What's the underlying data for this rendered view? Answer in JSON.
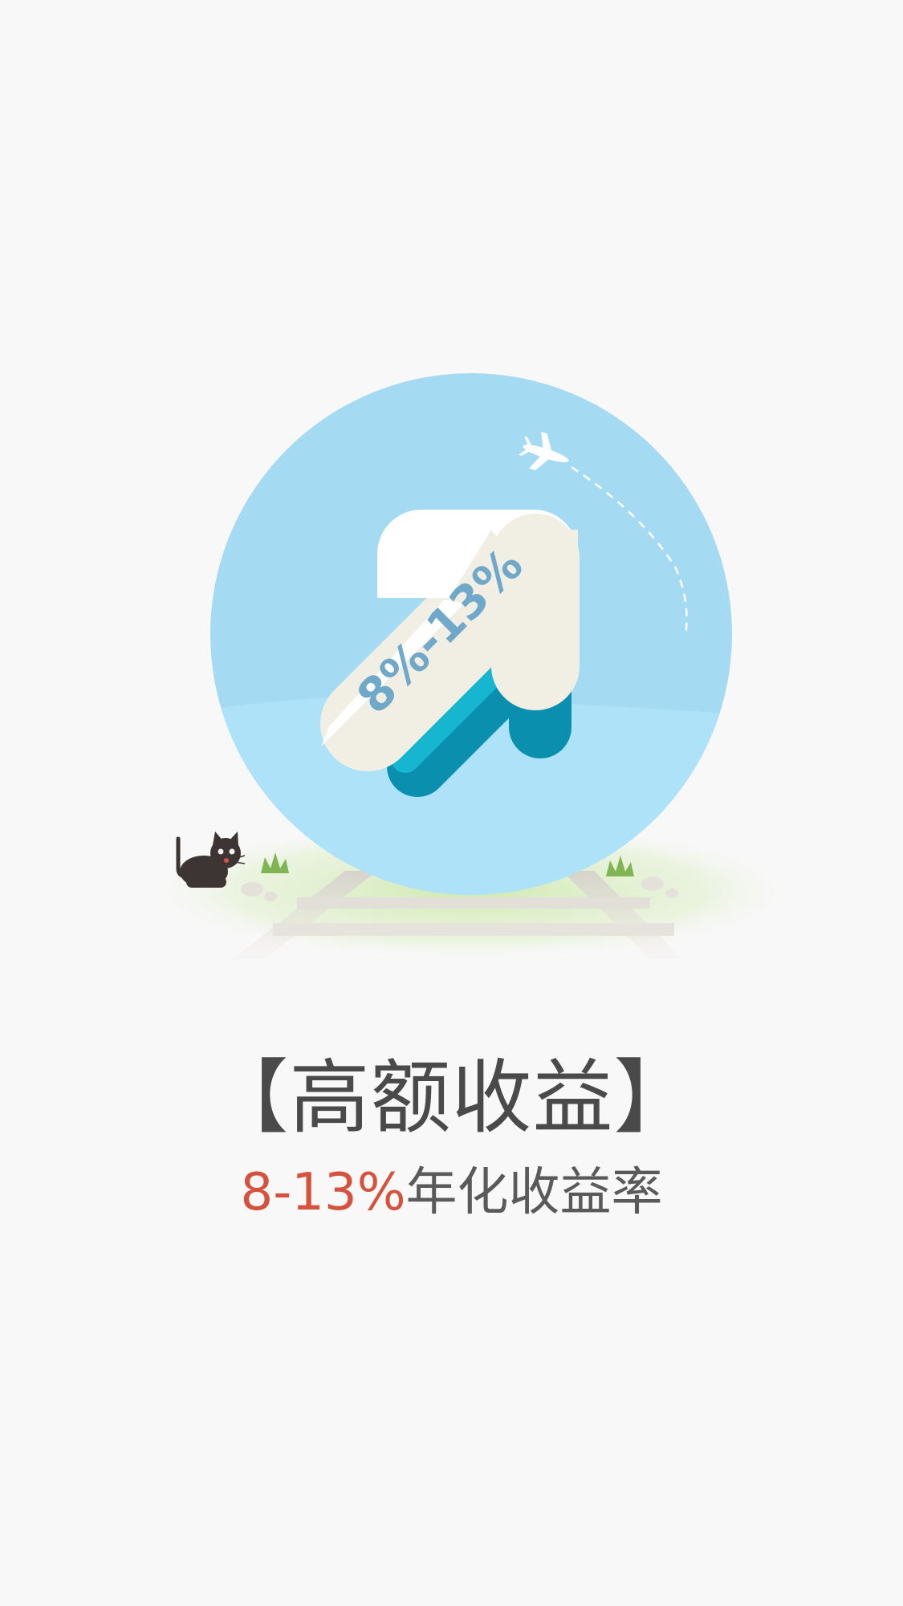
{
  "illustration": {
    "arrow_label": "8%-13%",
    "colors": {
      "background": "#f9f8f9",
      "circle": "#a8dcf4",
      "arrow_white": "#ffffff",
      "arrow_cream": "#f1efe4",
      "arrow_teal": "#0aa6c6",
      "label_blue": "#6fa8c8",
      "accent_red": "#d5533c"
    },
    "icons": [
      "airplane-icon",
      "cat-icon",
      "grass-icon",
      "pebble-icon",
      "railway-track"
    ]
  },
  "headline": {
    "title": "【高额收益】",
    "rate": "8-13%",
    "rate_desc": "年化收益率"
  }
}
